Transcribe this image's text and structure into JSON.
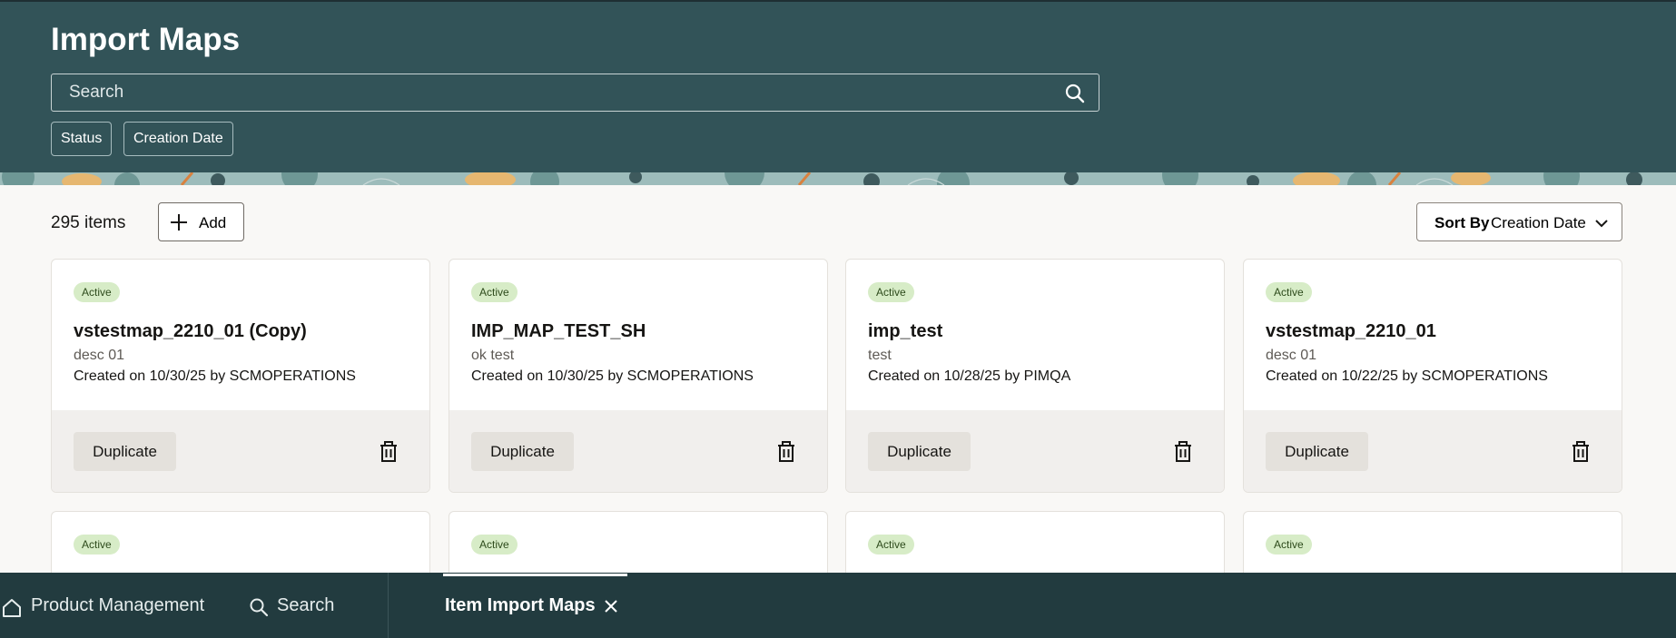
{
  "header": {
    "title": "Import Maps",
    "search_placeholder": "Search",
    "filters": [
      "Status",
      "Creation Date"
    ]
  },
  "toolbar": {
    "items_count": "295 items",
    "add_label": "Add",
    "sort_by_label": "Sort By",
    "sort_value": "Creation Date"
  },
  "cards": [
    {
      "status": "Active",
      "title": "vstestmap_2210_01 (Copy)",
      "description": "desc 01",
      "meta": "Created on 10/30/25 by SCMOPERATIONS",
      "duplicate_label": "Duplicate"
    },
    {
      "status": "Active",
      "title": "IMP_MAP_TEST_SH",
      "description": "ok test",
      "meta": "Created on 10/30/25 by SCMOPERATIONS",
      "duplicate_label": "Duplicate"
    },
    {
      "status": "Active",
      "title": "imp_test",
      "description": "test",
      "meta": "Created on 10/28/25 by PIMQA",
      "duplicate_label": "Duplicate"
    },
    {
      "status": "Active",
      "title": "vstestmap_2210_01",
      "description": "desc 01",
      "meta": "Created on 10/22/25 by SCMOPERATIONS",
      "duplicate_label": "Duplicate"
    }
  ],
  "partial_cards": [
    {
      "status": "Active"
    },
    {
      "status": "Active"
    },
    {
      "status": "Active"
    },
    {
      "status": "Active"
    }
  ],
  "taskbar": {
    "home_label": "Product Management",
    "search_label": "Search",
    "active_tab_label": "Item Import Maps"
  },
  "colors": {
    "header_bg": "#325358",
    "taskbar_bg": "#223b3f",
    "badge_bg": "#d7ecc7",
    "footer_bg": "#f1efed"
  }
}
